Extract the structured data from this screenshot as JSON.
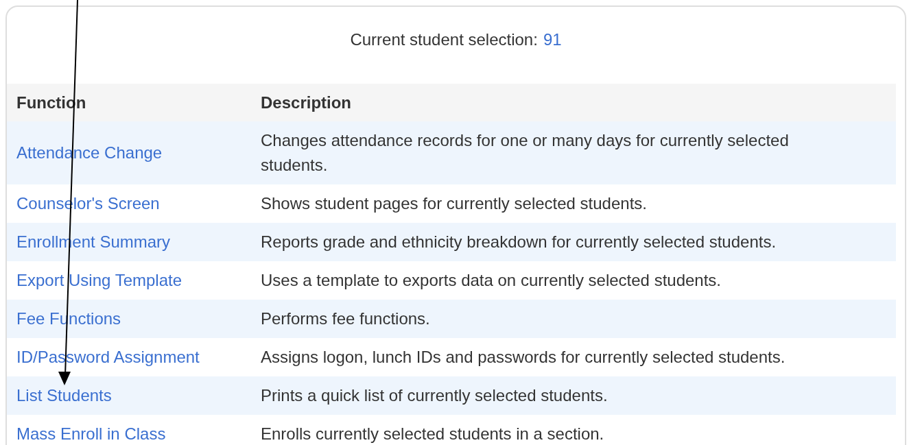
{
  "selection": {
    "label": "Current student selection:",
    "count": "91"
  },
  "table": {
    "columns": [
      "Function",
      "Description"
    ],
    "rows": [
      {
        "function": "Attendance Change",
        "description": "Changes attendance records for one or many days for currently selected students."
      },
      {
        "function": "Counselor's Screen",
        "description": "Shows student pages for currently selected students."
      },
      {
        "function": "Enrollment Summary",
        "description": "Reports grade and ethnicity breakdown for currently selected students."
      },
      {
        "function": "Export Using Template",
        "description": "Uses a template to exports data on currently selected students."
      },
      {
        "function": "Fee Functions",
        "description": "Performs fee functions."
      },
      {
        "function": "ID/Password Assignment",
        "description": "Assigns logon, lunch IDs and passwords for currently selected students."
      },
      {
        "function": "List Students",
        "description": "Prints a quick list of currently selected students."
      },
      {
        "function": "Mass Enroll in Class",
        "description": "Enrolls currently selected students in a section."
      }
    ]
  }
}
